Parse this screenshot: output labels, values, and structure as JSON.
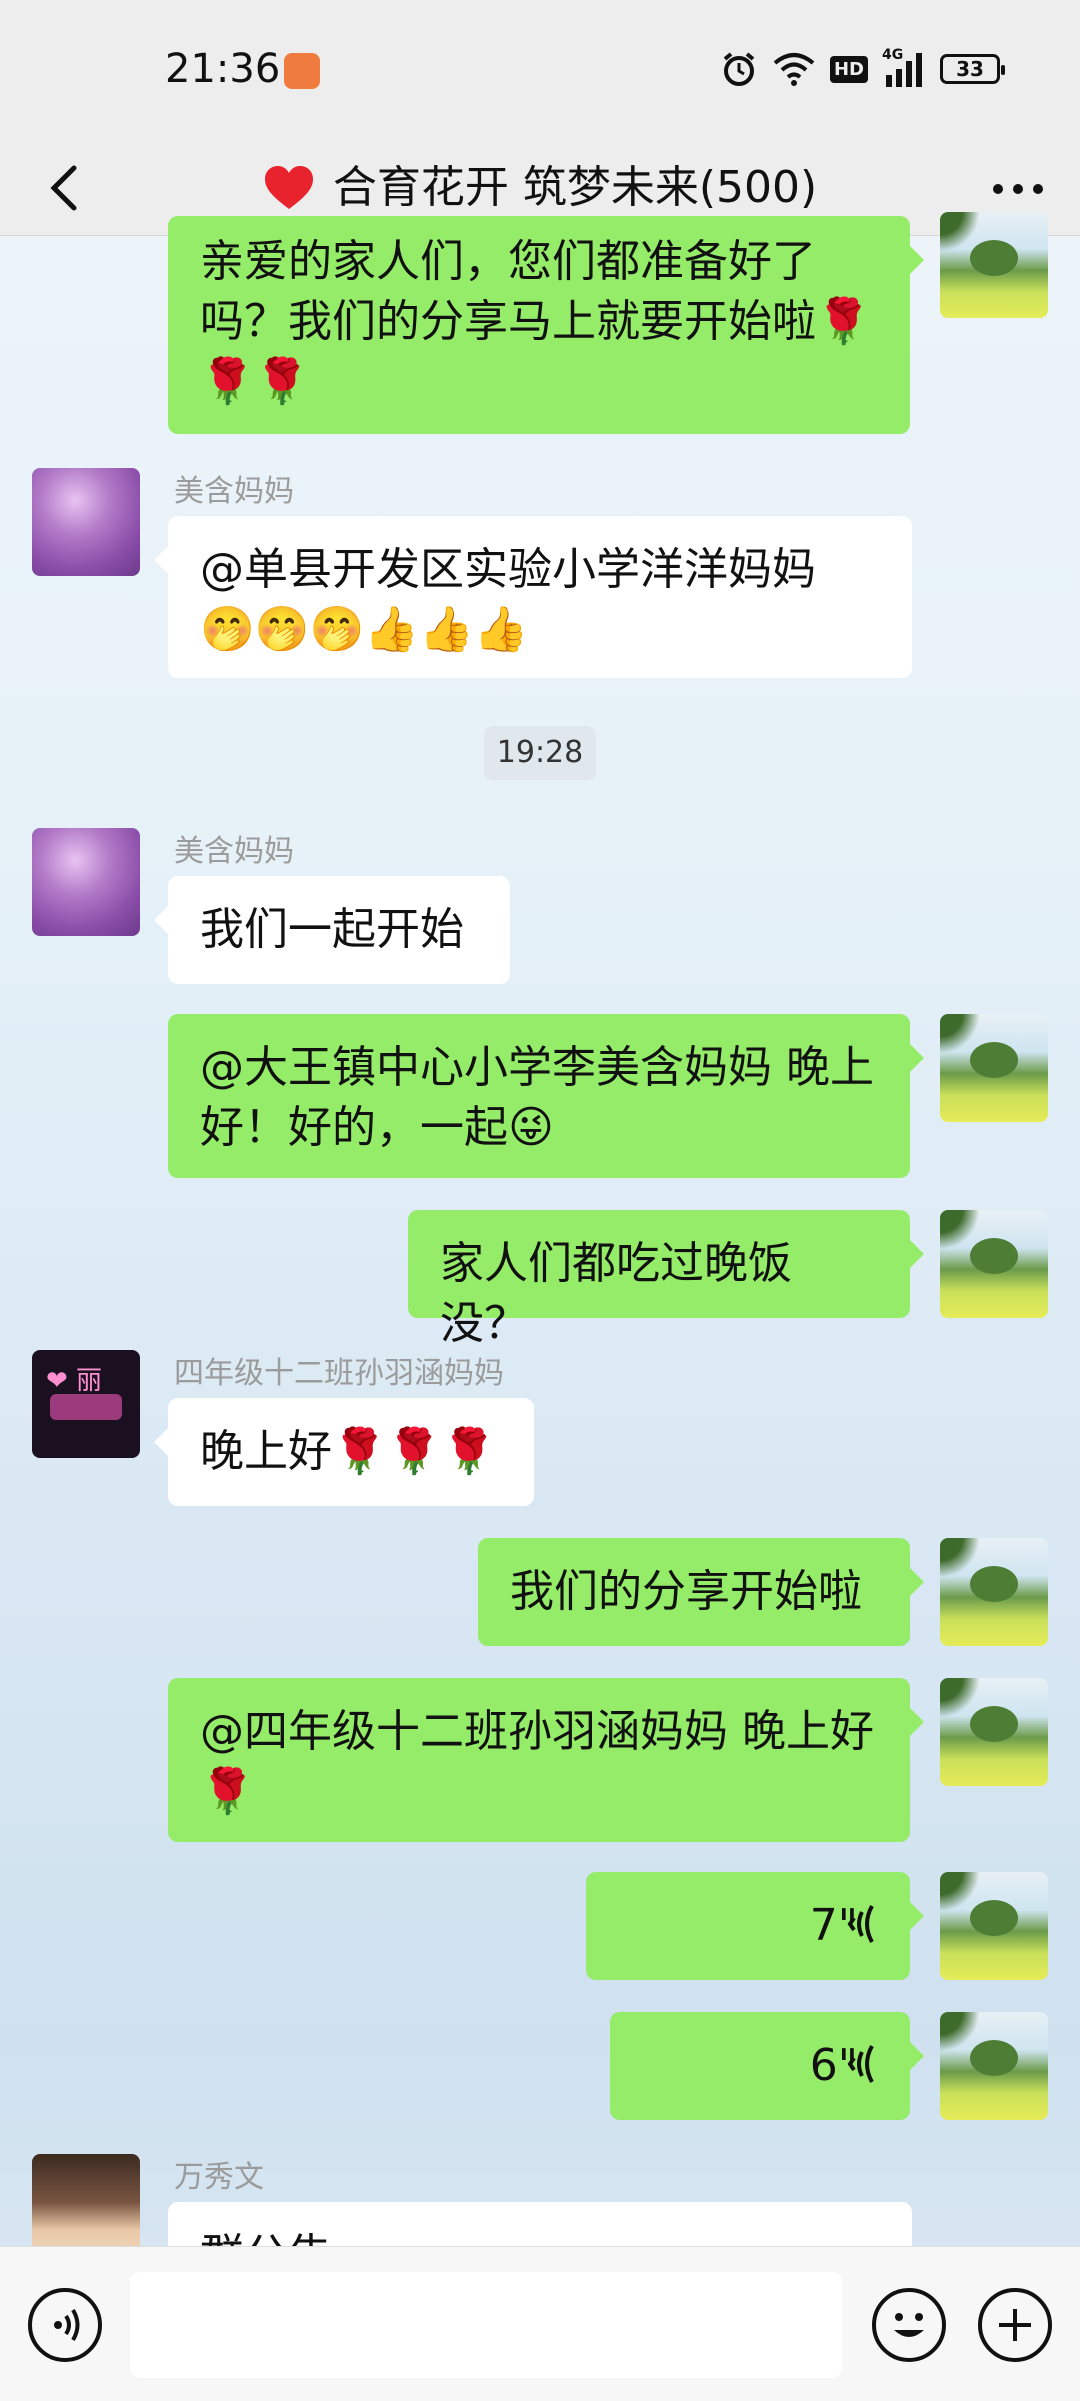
{
  "status_bar": {
    "time": "21:36",
    "network": "4G",
    "hd": "HD",
    "battery": "33"
  },
  "header": {
    "title": "合育花开 筑梦未来(500)",
    "title_icon": "red-heart-icon",
    "back_icon": "chevron-left-icon",
    "more_icon": "more-dots-icon"
  },
  "messages": [
    {
      "side": "right",
      "text": "亲爱的家人们，您们都准备好了吗？我们的分享马上就要开始啦🌹🌹🌹"
    },
    {
      "side": "left",
      "sender": "美含妈妈",
      "text": "@单县开发区实验小学洋洋妈妈 🤭🤭🤭👍👍👍"
    },
    {
      "timestamp": "19:28"
    },
    {
      "side": "left",
      "sender": "美含妈妈",
      "text": "我们一起开始"
    },
    {
      "side": "right",
      "text": "@大王镇中心小学李美含妈妈  晚上好！好的，一起😜"
    },
    {
      "side": "right",
      "text": "家人们都吃过晚饭没？"
    },
    {
      "side": "left",
      "sender": "四年级十二班孙羽涵妈妈",
      "text": "晚上好🌹🌹🌹"
    },
    {
      "side": "right",
      "text": "我们的分享开始啦"
    },
    {
      "side": "right",
      "text": "@四年级十二班孙羽涵妈妈  晚上好🌹"
    },
    {
      "side": "right",
      "voice": "7\""
    },
    {
      "side": "right",
      "voice": "6\""
    },
    {
      "side": "left",
      "sender": "万秀文",
      "text": "群公告"
    }
  ],
  "input_bar": {
    "voice_icon": "voice-mode-icon",
    "emoji_icon": "emoji-icon",
    "plus_icon": "plus-icon"
  },
  "colors": {
    "sent_bubble": "#95ec69",
    "received_bubble": "#ffffff",
    "bar": "#ededed"
  }
}
